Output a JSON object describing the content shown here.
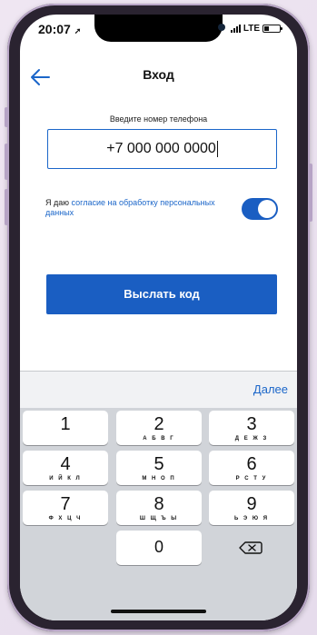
{
  "status_bar": {
    "time": "20:07",
    "carrier": "LTE"
  },
  "header": {
    "title": "Вход"
  },
  "form": {
    "phone_label": "Введите номер телефона",
    "phone_value": "+7 000 000 0000",
    "consent_prefix": "Я даю ",
    "consent_link": "согласие на обработку персональных данных",
    "consent_enabled": true,
    "submit_label": "Выслать код"
  },
  "keyboard": {
    "next_label": "Далее",
    "keys": [
      {
        "digit": "1",
        "letters": ""
      },
      {
        "digit": "2",
        "letters": "А Б В Г"
      },
      {
        "digit": "3",
        "letters": "Д Е Ж З"
      },
      {
        "digit": "4",
        "letters": "И Й К Л"
      },
      {
        "digit": "5",
        "letters": "М Н О П"
      },
      {
        "digit": "6",
        "letters": "Р С Т У"
      },
      {
        "digit": "7",
        "letters": "Ф Х Ц Ч"
      },
      {
        "digit": "8",
        "letters": "Ш Щ Ъ Ы"
      },
      {
        "digit": "9",
        "letters": "Ь Э Ю Я"
      },
      {
        "digit": "0",
        "letters": ""
      }
    ]
  },
  "colors": {
    "accent": "#1a5ec2",
    "link": "#1b66c9",
    "keyboard_bg": "#d1d4d9"
  }
}
